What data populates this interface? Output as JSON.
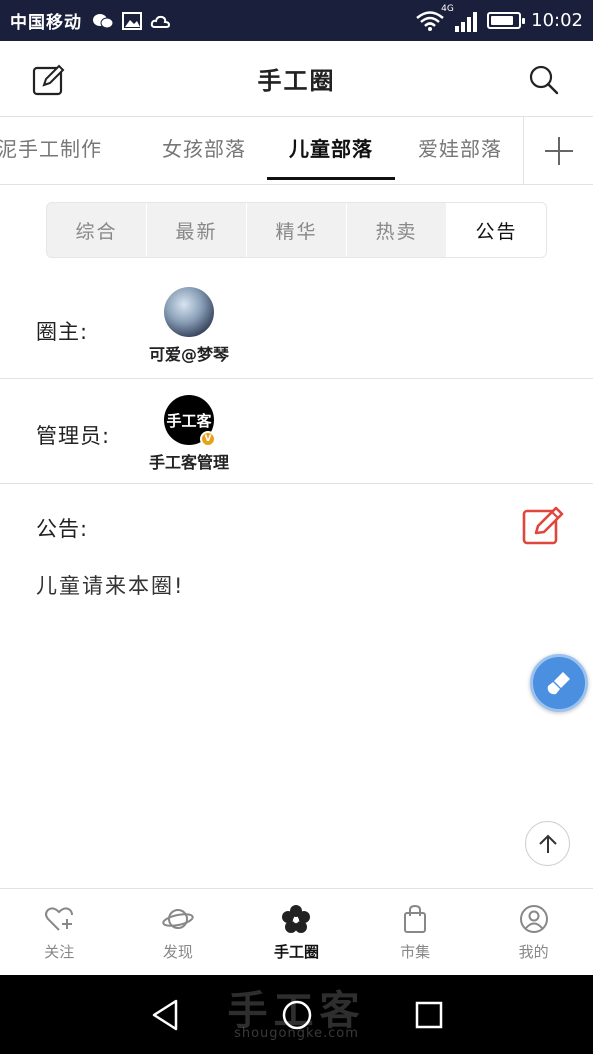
{
  "status_bar": {
    "carrier": "中国移动",
    "network": "4G",
    "time": "10:02",
    "battery_level": 0.85
  },
  "header": {
    "title": "手工圈"
  },
  "category_tabs": [
    {
      "label": "纸泥手工制作"
    },
    {
      "label": "女孩部落"
    },
    {
      "label": "儿童部落",
      "active": true
    },
    {
      "label": "爱娃部落"
    }
  ],
  "segments": [
    {
      "label": "综合"
    },
    {
      "label": "最新"
    },
    {
      "label": "精华"
    },
    {
      "label": "热卖"
    },
    {
      "label": "公告",
      "active": true
    }
  ],
  "owner": {
    "label": "圈主:",
    "name": "可爱@梦琴"
  },
  "admin": {
    "label": "管理员:",
    "name": "手工客管理",
    "avatar_text": "手工客",
    "badge": "V"
  },
  "notice": {
    "label": "公告:",
    "text": "儿童请来本圈!"
  },
  "bottom_nav": [
    {
      "label": "关注",
      "icon": "heart-plus-icon"
    },
    {
      "label": "发现",
      "icon": "planet-icon"
    },
    {
      "label": "手工圈",
      "icon": "flower-icon",
      "active": true
    },
    {
      "label": "市集",
      "icon": "shopping-bag-icon"
    },
    {
      "label": "我的",
      "icon": "user-icon"
    }
  ],
  "watermark": {
    "text": "手工客",
    "sub": "shougongke.com"
  },
  "colors": {
    "status_bar": "#1a1f3c",
    "accent_red": "#e0463c",
    "fab_blue": "#4a8fe0"
  }
}
